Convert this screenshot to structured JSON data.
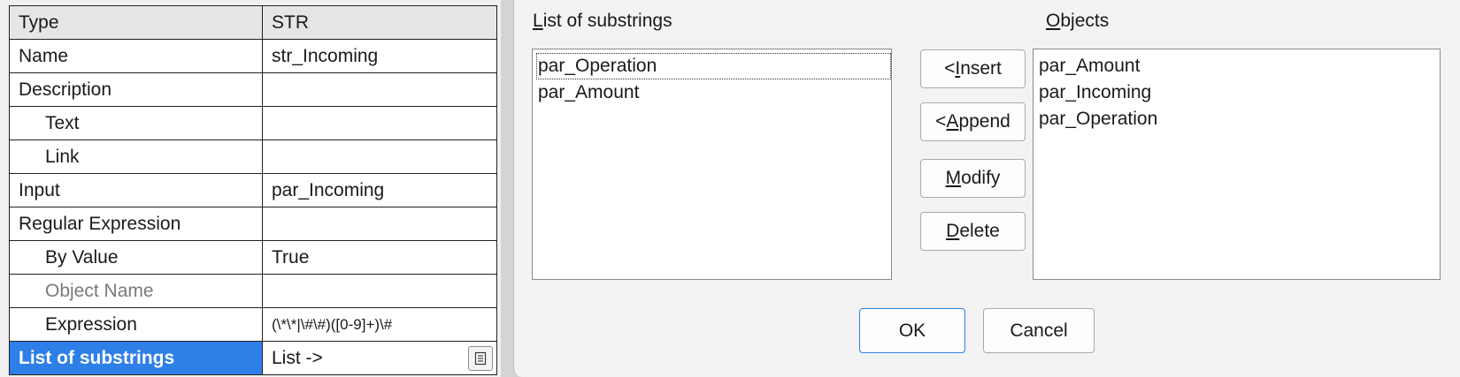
{
  "properties": {
    "rows": [
      {
        "label": "Type",
        "value": "STR"
      },
      {
        "label": "Name",
        "value": "str_Incoming"
      },
      {
        "label": "Description",
        "value": ""
      },
      {
        "label": "Text",
        "value": ""
      },
      {
        "label": "Link",
        "value": ""
      },
      {
        "label": "Input",
        "value": "par_Incoming"
      },
      {
        "label": "Regular Expression",
        "value": ""
      },
      {
        "label": "By Value",
        "value": "True"
      },
      {
        "label": "Object Name",
        "value": ""
      },
      {
        "label": "Expression",
        "value": "(\\*\\*|\\#\\#)([0-9]+)\\#"
      },
      {
        "label": "List of substrings",
        "value": "List ->"
      }
    ],
    "selected_color": "#2e7fe8"
  },
  "dialog": {
    "list_label_prefix": "L",
    "list_label_rest": "ist of substrings",
    "objects_label_prefix": "O",
    "objects_label_rest": "bjects",
    "substrings": [
      "par_Operation",
      "par_Amount"
    ],
    "objects": [
      "par_Amount",
      "par_Incoming",
      "par_Operation"
    ],
    "buttons": {
      "insert": {
        "pre": "< ",
        "key": "I",
        "rest": "nsert"
      },
      "append": {
        "pre": "< ",
        "key": "A",
        "rest": "ppend"
      },
      "modify": {
        "pre": "",
        "key": "M",
        "rest": "odify"
      },
      "delete": {
        "pre": "",
        "key": "D",
        "rest": "elete"
      },
      "ok": "OK",
      "cancel": "Cancel"
    }
  }
}
